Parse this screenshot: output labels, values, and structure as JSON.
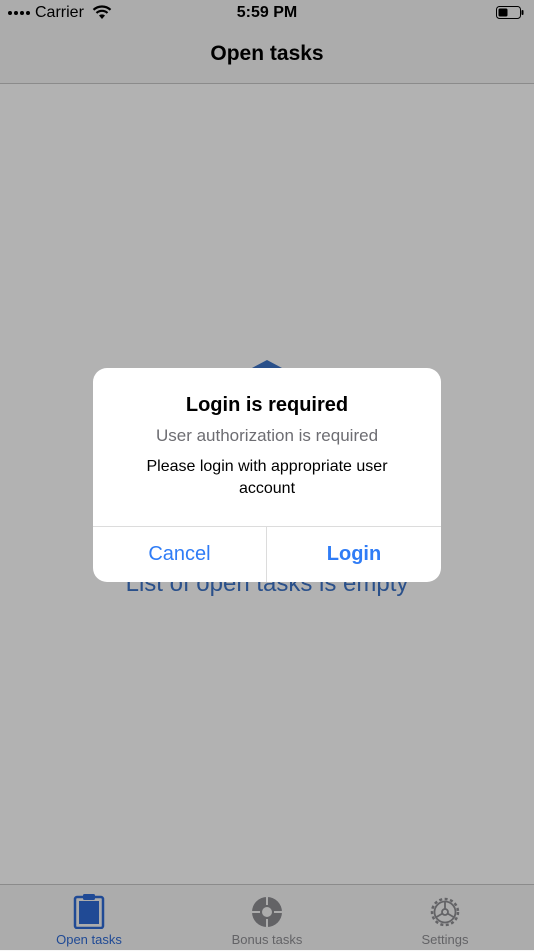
{
  "status_bar": {
    "carrier": "Carrier",
    "time": "5:59 PM"
  },
  "nav": {
    "title": "Open tasks"
  },
  "content": {
    "empty_message": "List of open tasks is empty"
  },
  "tabs": [
    {
      "label": "Open tasks",
      "icon": "clipboard-icon",
      "active": true
    },
    {
      "label": "Bonus tasks",
      "icon": "target-icon",
      "active": false
    },
    {
      "label": "Settings",
      "icon": "gear-icon",
      "active": false
    }
  ],
  "alert": {
    "title": "Login is required",
    "subtitle": "User authorization is required",
    "message": "Please login with appropriate user account",
    "cancel_label": "Cancel",
    "login_label": "Login"
  },
  "colors": {
    "accent": "#2f7cf6",
    "tab_active": "#2f6bd6",
    "empty_text": "#3d73c6"
  }
}
